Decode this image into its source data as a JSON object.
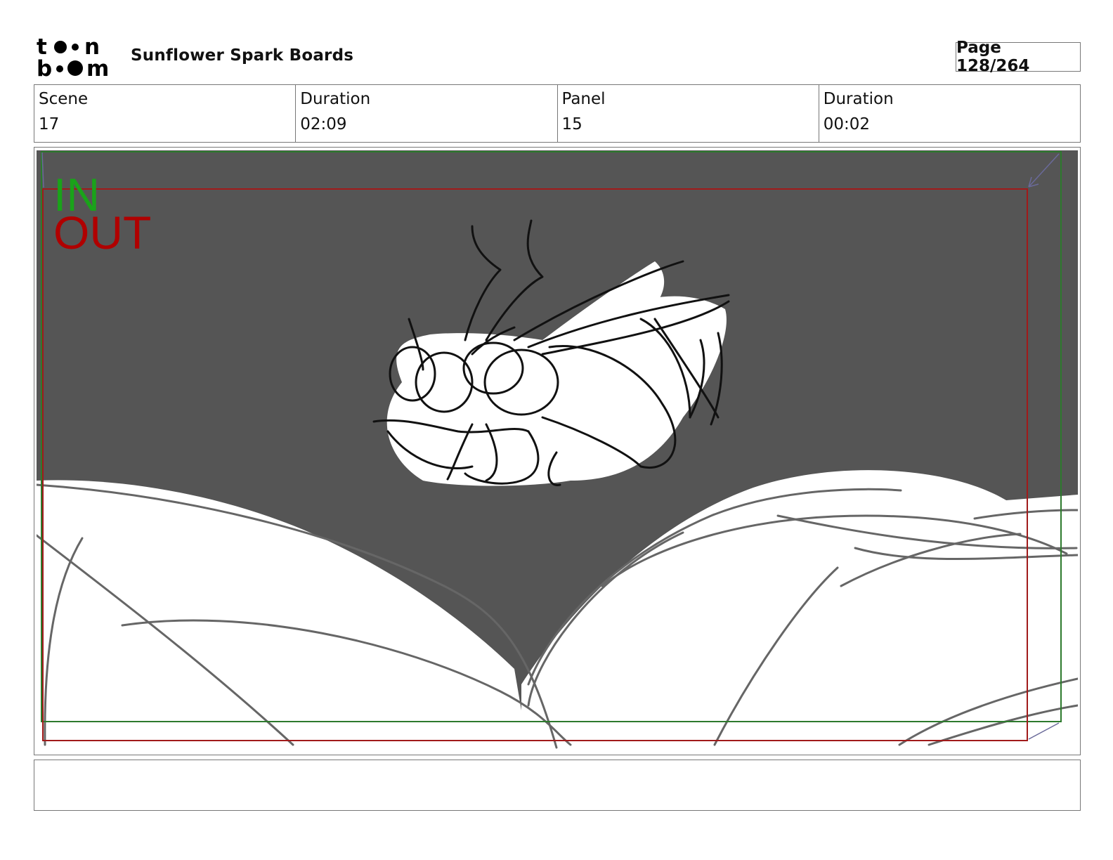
{
  "header": {
    "logo_line1": "toon",
    "logo_line2": "boom",
    "project_title": "Sunflower Spark Boards",
    "page_label": "Page 128/264"
  },
  "info": {
    "scene_label": "Scene",
    "scene_value": "17",
    "scene_duration_label": "Duration",
    "scene_duration_value": "02:09",
    "panel_label": "Panel",
    "panel_value": "15",
    "panel_duration_label": "Duration",
    "panel_duration_value": "00:02"
  },
  "panel": {
    "in_label": "IN",
    "out_label": "OUT",
    "in_color": "#1aa31a",
    "out_color": "#b00000",
    "background_color": "#555555"
  },
  "notes": {
    "text": ""
  }
}
